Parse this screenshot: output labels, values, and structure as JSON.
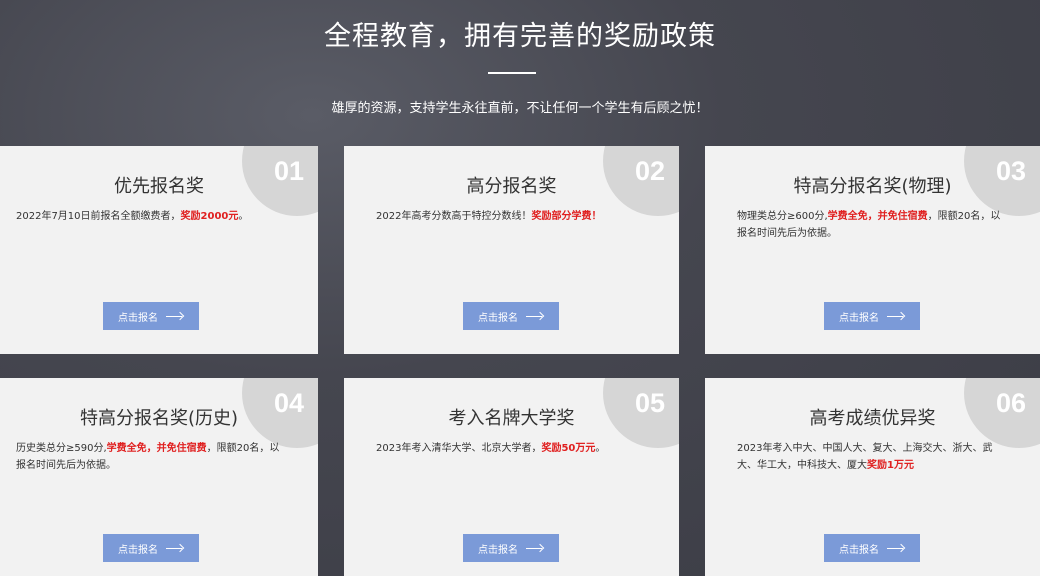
{
  "hero": {
    "title": "全程教育，拥有完善的奖励政策",
    "subtitle": "雄厚的资源，支持学生永往直前，不让任何一个学生有后顾之忧！"
  },
  "colors": {
    "accent": "#7b9ad8",
    "highlight": "#e02020",
    "card_bg": "#f2f2f2"
  },
  "cards": [
    {
      "num": "01",
      "title": "优先报名奖",
      "desc_plain": "2022年7月10日前报名全额缴费者，",
      "desc_highlight": "奖励2000元",
      "desc_tail": "。",
      "button": "点击报名"
    },
    {
      "num": "02",
      "title": "高分报名奖",
      "desc_plain": "2022年高考分数高于特控分数线！",
      "desc_highlight": "奖励部分学费！",
      "desc_tail": "",
      "button": "点击报名"
    },
    {
      "num": "03",
      "title": "特高分报名奖(物理)",
      "desc_plain": "物理类总分≥600分,",
      "desc_highlight": "学费全免，并免住宿费",
      "desc_tail": "，限额20名，以报名时间先后为依据。",
      "button": "点击报名"
    },
    {
      "num": "04",
      "title": "特高分报名奖(历史)",
      "desc_plain": "历史类总分≥590分,",
      "desc_highlight": "学费全免，并免住宿费",
      "desc_tail": "，限额20名，以报名时间先后为依据。",
      "button": "点击报名"
    },
    {
      "num": "05",
      "title": "考入名牌大学奖",
      "desc_plain": "2023年考入清华大学、北京大学者，",
      "desc_highlight": "奖励50万元",
      "desc_tail": "。",
      "button": "点击报名"
    },
    {
      "num": "06",
      "title": "高考成绩优异奖",
      "desc_plain": "2023年考入中大、中国人大、复大、上海交大、浙大、武大、华工大，中科技大、厦大",
      "desc_highlight": "奖励1万元",
      "desc_tail": "",
      "button": "点击报名"
    }
  ]
}
